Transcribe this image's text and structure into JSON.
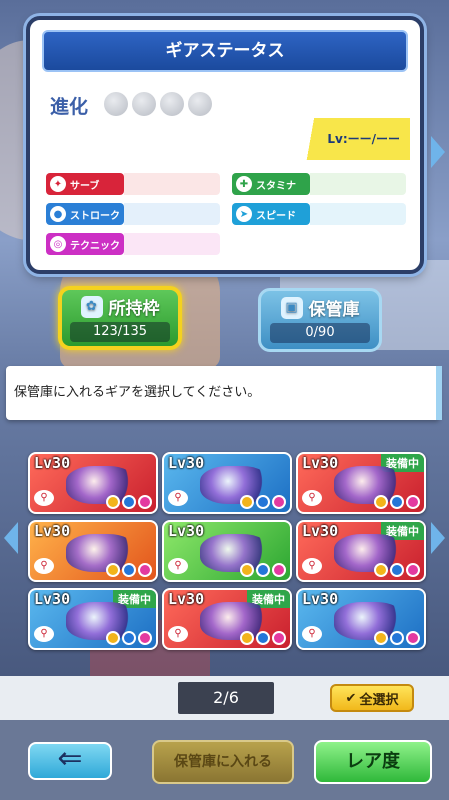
{
  "status_panel": {
    "title": "ギアステータス",
    "evolution_label": "進化",
    "evolution_stars": 0,
    "level_label": "Lv:ーー/ーー",
    "stats": [
      {
        "label": "サーブ",
        "color": "#d8243a"
      },
      {
        "label": "スタミナ",
        "color": "#2fa34a"
      },
      {
        "label": "ストローク",
        "color": "#2b7fd6"
      },
      {
        "label": "スピード",
        "color": "#1fa0d8"
      },
      {
        "label": "テクニック",
        "color": "#cc2fc4"
      }
    ]
  },
  "tabs": {
    "owned": {
      "label": "所持枠",
      "count": "123/135"
    },
    "storage": {
      "label": "保管庫",
      "count": "0/90"
    }
  },
  "instruction": "保管庫に入れるギアを選択してください。",
  "gears": [
    {
      "level": "30",
      "equipped": "",
      "color": "red",
      "type": "racket"
    },
    {
      "level": "30",
      "equipped": "",
      "color": "blue",
      "type": "racket"
    },
    {
      "level": "30",
      "equipped": "装備中",
      "color": "red",
      "type": "racket"
    },
    {
      "level": "30",
      "equipped": "",
      "color": "orange",
      "type": "racket"
    },
    {
      "level": "30",
      "equipped": "",
      "color": "green",
      "type": "badge"
    },
    {
      "level": "30",
      "equipped": "装備中",
      "color": "red",
      "type": "racket"
    },
    {
      "level": "30",
      "equipped": "装備中",
      "color": "blue",
      "type": "racket"
    },
    {
      "level": "30",
      "equipped": "装備中",
      "color": "red",
      "type": "racket"
    },
    {
      "level": "30",
      "equipped": "",
      "color": "blue",
      "type": "shoes"
    }
  ],
  "pager": {
    "indicator": "2/6",
    "select_all": "全選択"
  },
  "buttons": {
    "back": "⇐",
    "store": "保管庫に入れる",
    "rarity": "レア度"
  }
}
